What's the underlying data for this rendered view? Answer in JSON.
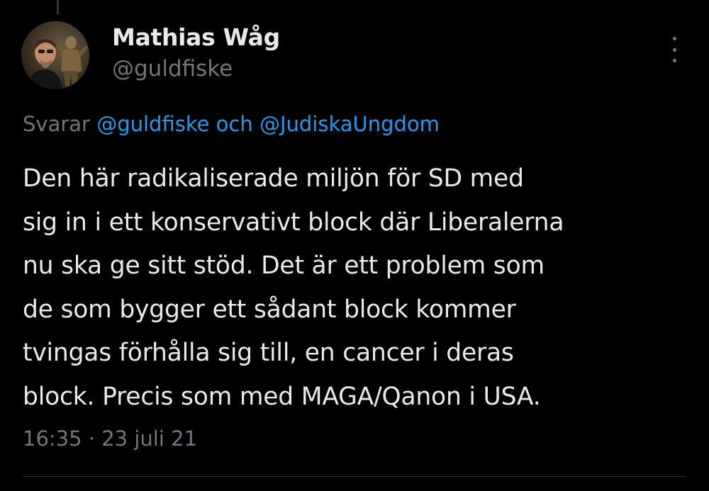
{
  "author": {
    "display_name": "Mathias Wåg",
    "handle": "@guldfiske"
  },
  "reply_context": {
    "prefix": "Svarar",
    "mention_1": "@guldfiske",
    "conjunction": "och",
    "mention_2": "@JudiskaUngdom"
  },
  "tweet": {
    "lines": [
      "Den här radikaliserade miljön för SD med",
      "sig in i ett konservativt block där Liberalerna",
      "nu ska ge sitt stöd. Det är ett problem som",
      "de som bygger ett sådant block kommer",
      "tvingas förhålla sig till, en cancer i deras",
      "block. Precis som med MAGA/Qanon i USA."
    ]
  },
  "meta": {
    "time": "16:35",
    "separator": "·",
    "date": "23 juli 21"
  },
  "icons": {
    "more": "more-vertical-icon"
  },
  "colors": {
    "background": "#000000",
    "text": "#e7e9ea",
    "secondary": "#71767b",
    "link": "#1d9bf0",
    "divider": "#2f3336"
  }
}
